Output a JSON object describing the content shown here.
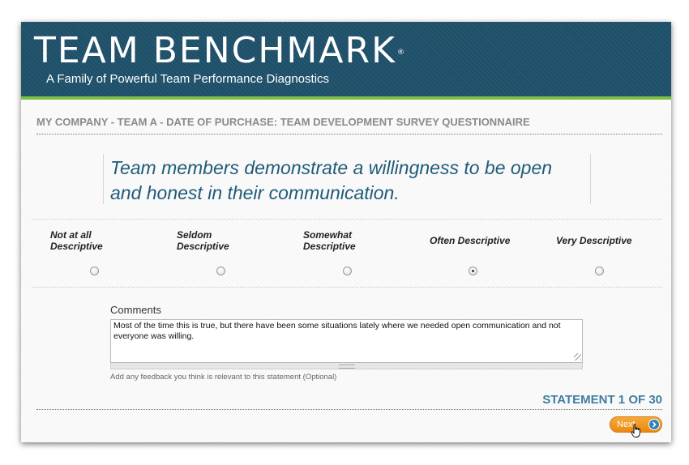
{
  "header": {
    "logo_text": "TEAM BENCHMARK",
    "logo_mark": "®",
    "tagline": "A Family of Powerful Team Performance Diagnostics"
  },
  "breadcrumb": "MY COMPANY - TEAM A - DATE OF PURCHASE: TEAM DEVELOPMENT SURVEY QUESTIONNAIRE",
  "statement": {
    "text": "Team members demonstrate a willingness to be open and honest in their communication."
  },
  "scale": {
    "options": [
      {
        "line1": "Not  at  all",
        "line2": "Descriptive",
        "selected": false
      },
      {
        "line1": "Seldom",
        "line2": "Descriptive",
        "selected": false
      },
      {
        "line1": "Somewhat",
        "line2": "Descriptive",
        "selected": false
      },
      {
        "line1": "Often  Descriptive",
        "line2": "",
        "selected": true
      },
      {
        "line1": "Very  Descriptive",
        "line2": "",
        "selected": false
      }
    ],
    "selected_index": 3
  },
  "comments": {
    "label": "Comments",
    "value": "Most of the time this is true, but there have been some situations lately where we needed open communication and not everyone was willing.",
    "helper": "Add any feedback you think is relevant to this statement (Optional)"
  },
  "progress": {
    "label": "STATEMENT 1 OF 30",
    "current": 1,
    "total": 30
  },
  "navigation": {
    "next_label": "Next"
  },
  "colors": {
    "banner": "#1f5069",
    "accent_green": "#7cc142",
    "statement_text": "#1f5b78",
    "button_orange": "#ea8a10",
    "counter_blue": "#3e7da1"
  },
  "icons": [
    "arrow-right-circle-icon",
    "hand-cursor-icon"
  ]
}
